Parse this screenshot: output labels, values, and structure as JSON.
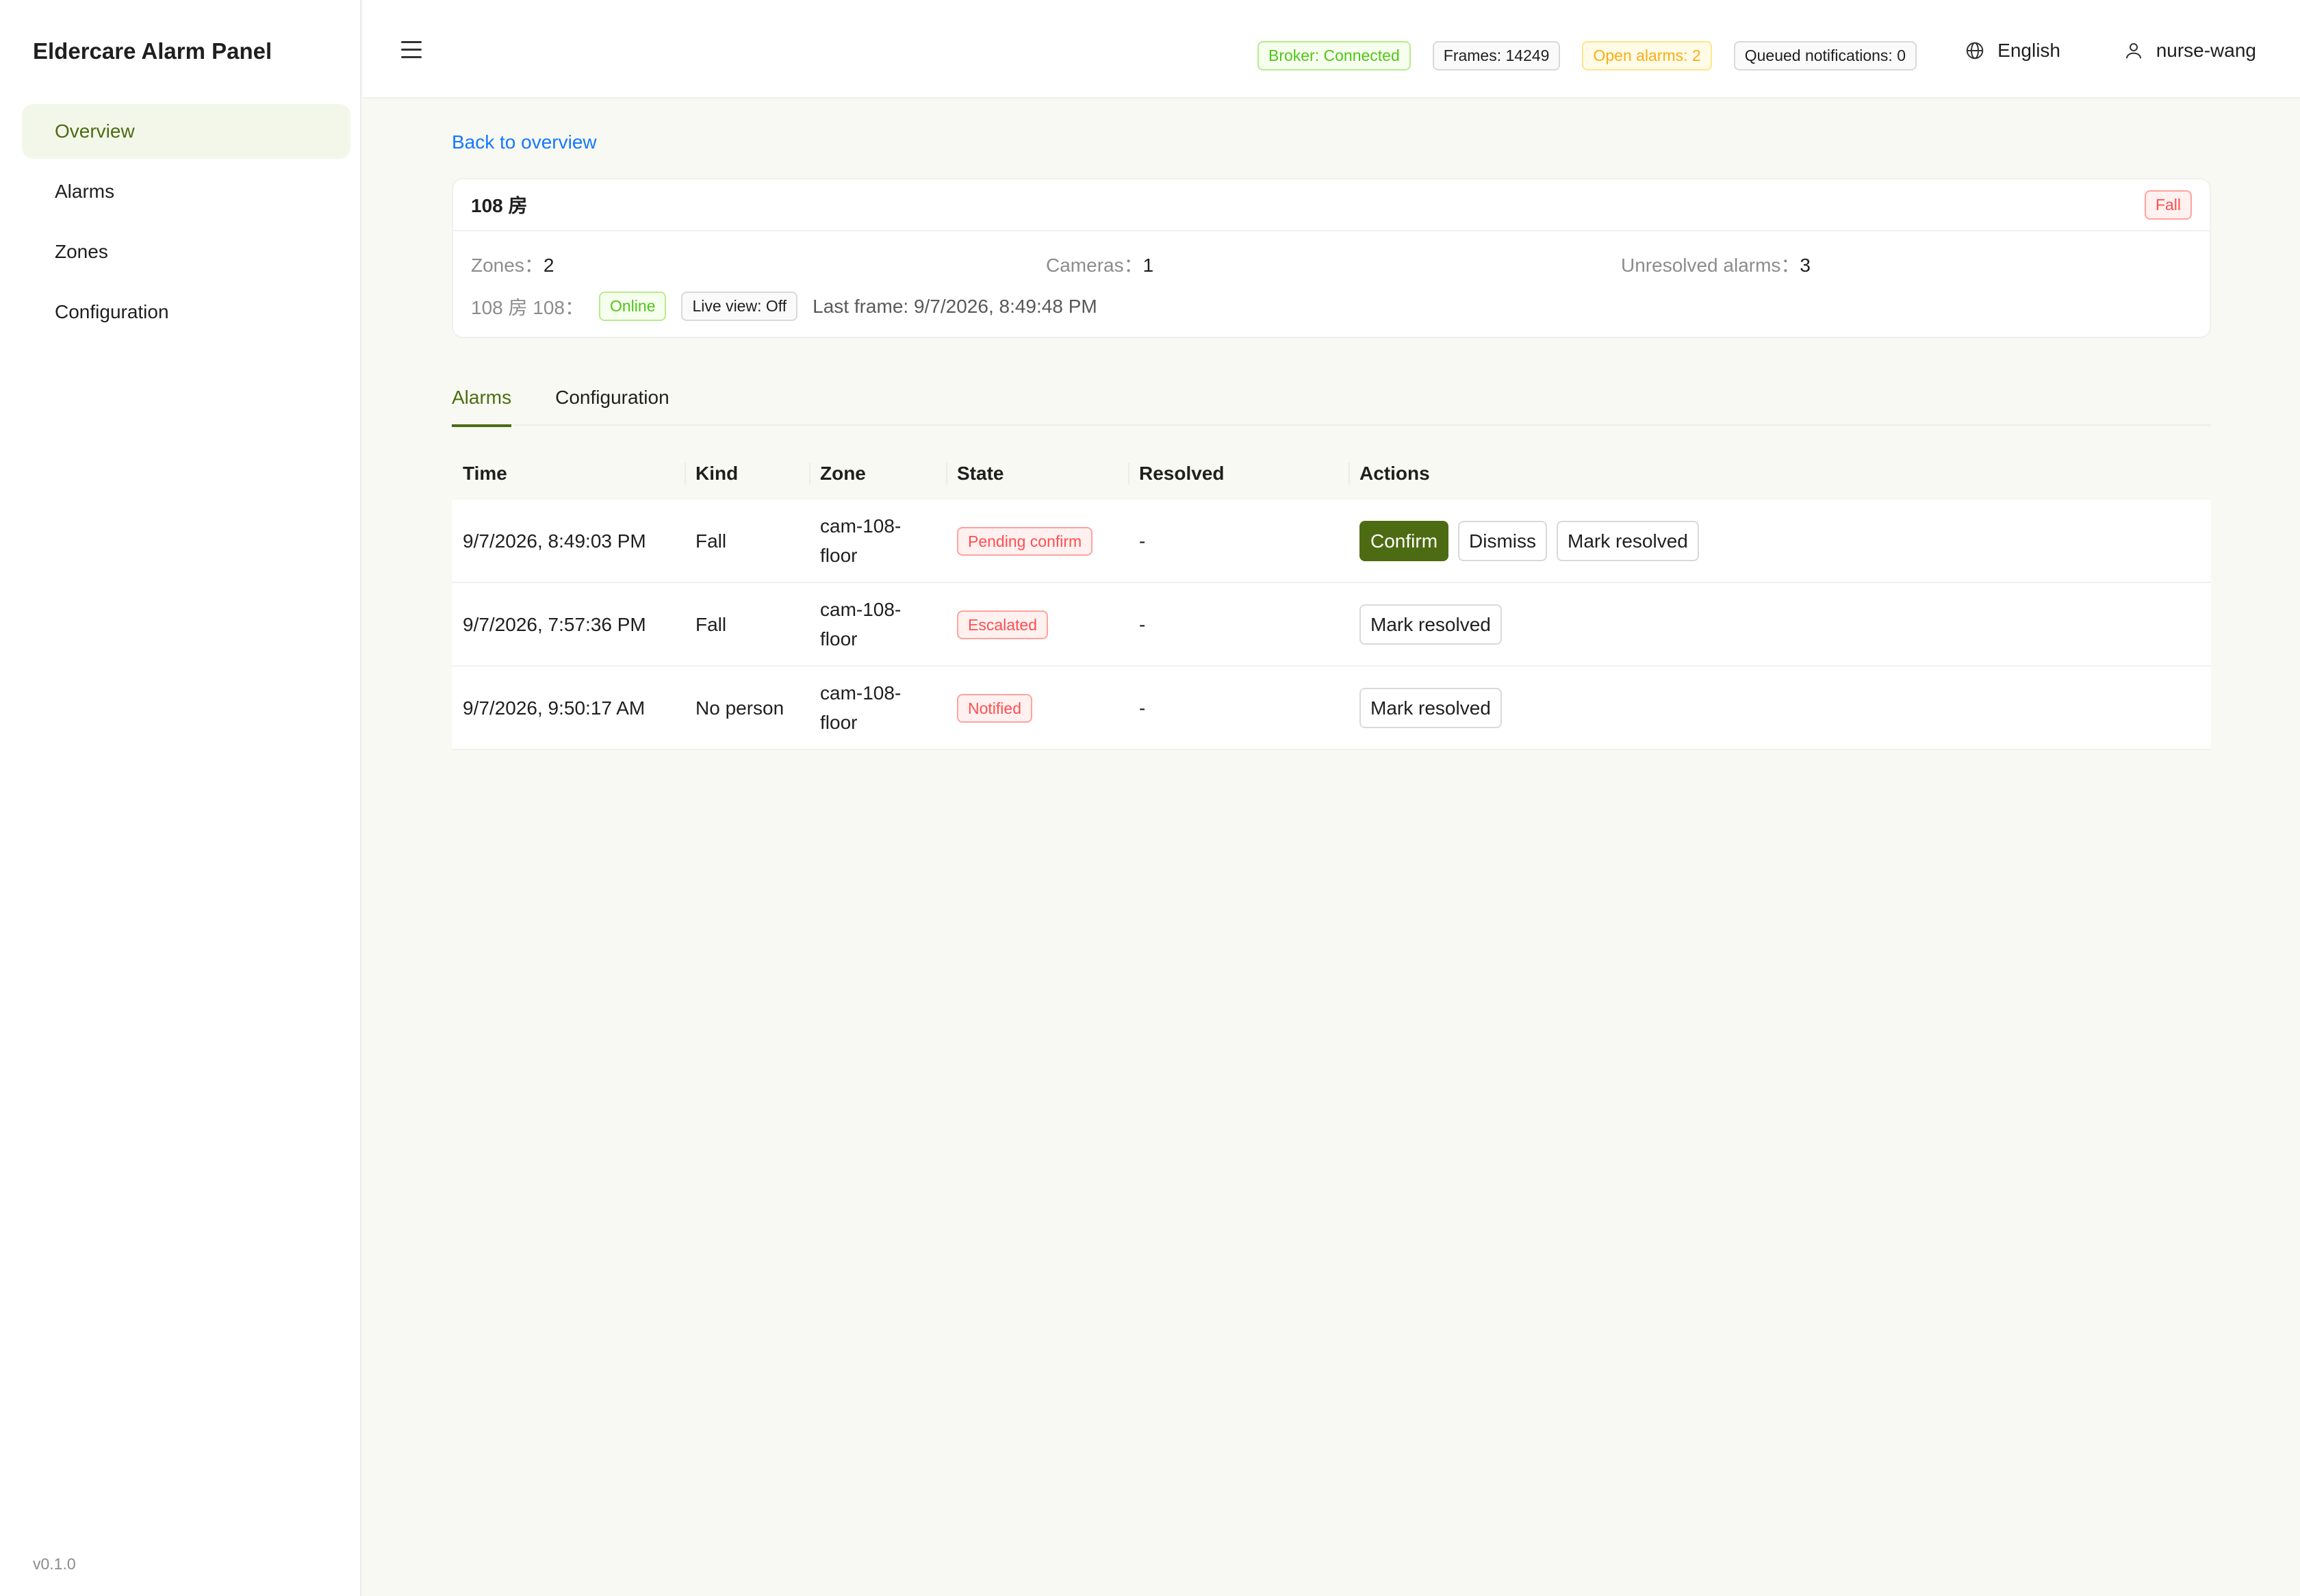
{
  "app": {
    "title": "Eldercare Alarm Panel",
    "version": "v0.1.0"
  },
  "sidebar": {
    "items": [
      {
        "label": "Overview",
        "active": true
      },
      {
        "label": "Alarms"
      },
      {
        "label": "Zones"
      },
      {
        "label": "Configuration"
      }
    ]
  },
  "header": {
    "broker": "Broker: Connected",
    "frames": "Frames: 14249",
    "open_alarms": "Open alarms: 2",
    "queued": "Queued notifications: 0",
    "language": "English",
    "user": "nurse-wang"
  },
  "content": {
    "back_link": "Back to overview",
    "room": {
      "title": "108 房",
      "kind_tag": "Fall",
      "zones_label": "Zones：",
      "zones_value": "2",
      "cameras_label": "Cameras：",
      "cameras_value": "1",
      "unresolved_label": "Unresolved alarms：",
      "unresolved_value": "3",
      "camera_label": "108 房 108：",
      "camera_status": "Online",
      "live_view": "Live view: Off",
      "last_frame": "Last frame: 9/7/2026, 8:49:48 PM"
    },
    "tabs": [
      "Alarms",
      "Configuration"
    ],
    "table": {
      "headers": [
        "Time",
        "Kind",
        "Zone",
        "State",
        "Resolved",
        "Actions"
      ],
      "rows": [
        {
          "time": "9/7/2026, 8:49:03 PM",
          "kind": "Fall",
          "zone_a": "cam-108-",
          "zone_b": "floor",
          "state": "Pending confirm",
          "resolved": "-",
          "actions": [
            "Confirm",
            "Dismiss",
            "Mark resolved"
          ]
        },
        {
          "time": "9/7/2026, 7:57:36 PM",
          "kind": "Fall",
          "zone_a": "cam-108-",
          "zone_b": "floor",
          "state": "Escalated",
          "resolved": "-",
          "actions": [
            "Mark resolved"
          ]
        },
        {
          "time": "9/7/2026, 9:50:17 AM",
          "kind": "No person",
          "zone_a": "cam-108-",
          "zone_b": "floor",
          "state": "Notified",
          "resolved": "-",
          "actions": [
            "Mark resolved"
          ]
        }
      ]
    }
  },
  "colors": {
    "accent": "#4d6b12",
    "link": "#1677ff",
    "danger": "#ff4d4f",
    "success": "#52c41a",
    "warning": "#faad14"
  },
  "icons": {
    "menu": "menu-icon",
    "language": "globe-icon",
    "user": "user-icon"
  }
}
